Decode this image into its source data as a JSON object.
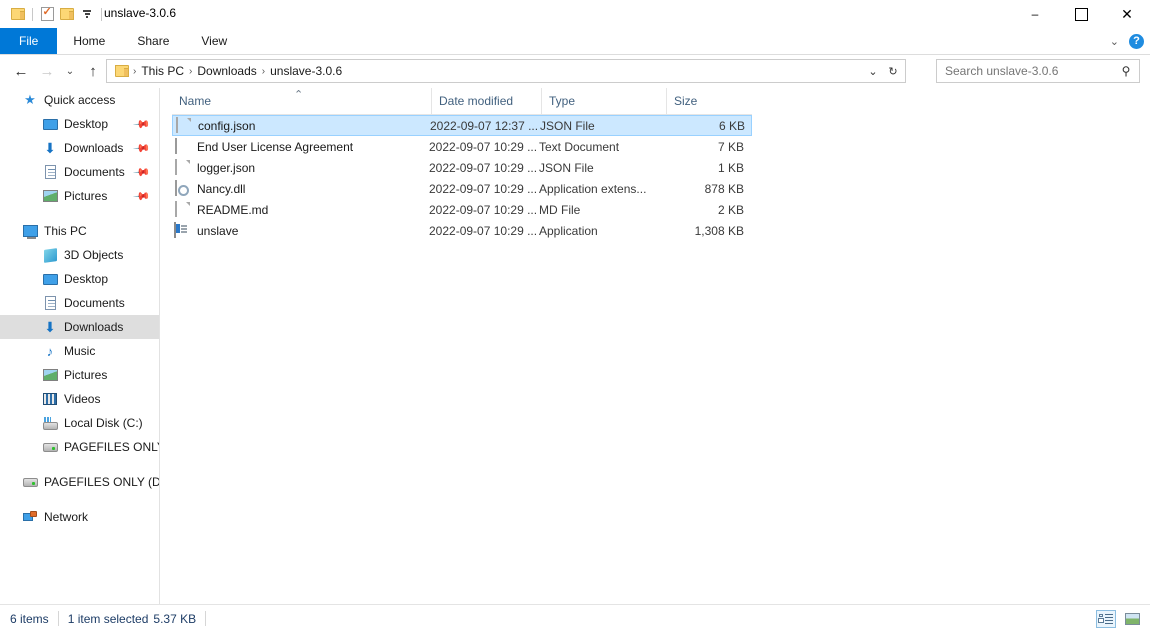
{
  "window": {
    "title": "unslave-3.0.6",
    "quick_access_toolbar": [
      {
        "name": "folder-icon",
        "label": "Folder"
      },
      {
        "name": "properties-icon",
        "label": "Properties"
      },
      {
        "name": "new-folder-icon",
        "label": "New folder"
      },
      {
        "name": "customize-caret-icon",
        "label": "Customize Quick Access Toolbar"
      }
    ],
    "controls": {
      "minimize": "–",
      "maximize": "☐",
      "close": "✕"
    }
  },
  "ribbon": {
    "tabs": [
      {
        "label": "File",
        "active": true
      },
      {
        "label": "Home",
        "active": false
      },
      {
        "label": "Share",
        "active": false
      },
      {
        "label": "View",
        "active": false
      }
    ],
    "collapse_icon": "⌄",
    "help_icon": "?"
  },
  "address": {
    "back_icon": "←",
    "forward_icon": "→",
    "recent_icon": "⌄",
    "up_icon": "↑",
    "crumbs": [
      "This PC",
      "Downloads",
      "unslave-3.0.6"
    ],
    "crumb_separator": "›",
    "dropdown_icon": "⌄",
    "refresh_icon": "↻"
  },
  "search": {
    "value": "",
    "placeholder": "Search unslave-3.0.6",
    "icon": "⚲"
  },
  "sidebar": {
    "groups": [
      {
        "header": {
          "label": "Quick access",
          "icon": "star-icon"
        },
        "items": [
          {
            "label": "Desktop",
            "icon": "monitor-icon",
            "pinned": true
          },
          {
            "label": "Downloads",
            "icon": "download-icon",
            "pinned": true
          },
          {
            "label": "Documents",
            "icon": "document-icon",
            "pinned": true
          },
          {
            "label": "Pictures",
            "icon": "picture-icon",
            "pinned": true
          }
        ]
      },
      {
        "header": {
          "label": "This PC",
          "icon": "pc-icon"
        },
        "items": [
          {
            "label": "3D Objects",
            "icon": "3d-objects-icon",
            "pinned": false
          },
          {
            "label": "Desktop",
            "icon": "monitor-icon",
            "pinned": false
          },
          {
            "label": "Documents",
            "icon": "document-icon",
            "pinned": false
          },
          {
            "label": "Downloads",
            "icon": "download-icon",
            "pinned": false,
            "selected": true
          },
          {
            "label": "Music",
            "icon": "music-icon",
            "pinned": false
          },
          {
            "label": "Pictures",
            "icon": "picture-icon",
            "pinned": false
          },
          {
            "label": "Videos",
            "icon": "video-icon",
            "pinned": false
          },
          {
            "label": "Local Disk (C:)",
            "icon": "local-disk-icon",
            "pinned": false
          },
          {
            "label": "PAGEFILES ONLY (D",
            "icon": "drive-icon",
            "pinned": false
          }
        ]
      },
      {
        "header": null,
        "items": [
          {
            "label": "PAGEFILES ONLY (D:)",
            "icon": "drive-icon",
            "pinned": false
          }
        ]
      },
      {
        "header": null,
        "items": [
          {
            "label": "Network",
            "icon": "network-icon",
            "pinned": false
          }
        ]
      }
    ]
  },
  "filelist": {
    "columns": [
      {
        "label": "Name",
        "sorted": "asc",
        "sort_icon": "⌃"
      },
      {
        "label": "Date modified",
        "sorted": null
      },
      {
        "label": "Type",
        "sorted": null
      },
      {
        "label": "Size",
        "sorted": null
      }
    ],
    "rows": [
      {
        "name": "config.json",
        "date": "2022-09-07 12:37 ...",
        "type": "JSON File",
        "size": "6 KB",
        "icon": "json-file-icon",
        "selected": true
      },
      {
        "name": "End User License Agreement",
        "date": "2022-09-07 10:29 ...",
        "type": "Text Document",
        "size": "7 KB",
        "icon": "text-document-icon",
        "selected": false
      },
      {
        "name": "logger.json",
        "date": "2022-09-07 10:29 ...",
        "type": "JSON File",
        "size": "1 KB",
        "icon": "json-file-icon",
        "selected": false
      },
      {
        "name": "Nancy.dll",
        "date": "2022-09-07 10:29 ...",
        "type": "Application extens...",
        "size": "878 KB",
        "icon": "dll-file-icon",
        "selected": false
      },
      {
        "name": "README.md",
        "date": "2022-09-07 10:29 ...",
        "type": "MD File",
        "size": "2 KB",
        "icon": "md-file-icon",
        "selected": false
      },
      {
        "name": "unslave",
        "date": "2022-09-07 10:29 ...",
        "type": "Application",
        "size": "1,308 KB",
        "icon": "application-icon",
        "selected": false
      }
    ]
  },
  "status": {
    "item_count": "6 items",
    "selection": "1 item selected",
    "selection_size": "5.37 KB",
    "views": [
      {
        "name": "details-view-button",
        "active": true
      },
      {
        "name": "large-icons-view-button",
        "active": false
      }
    ]
  },
  "colors": {
    "accent": "#0078d7",
    "selection": "#cce8ff",
    "selection_border": "#99d1ff",
    "sidebar_selection": "#dedede",
    "header_text": "#42617f",
    "status_text": "#1d3c66"
  }
}
